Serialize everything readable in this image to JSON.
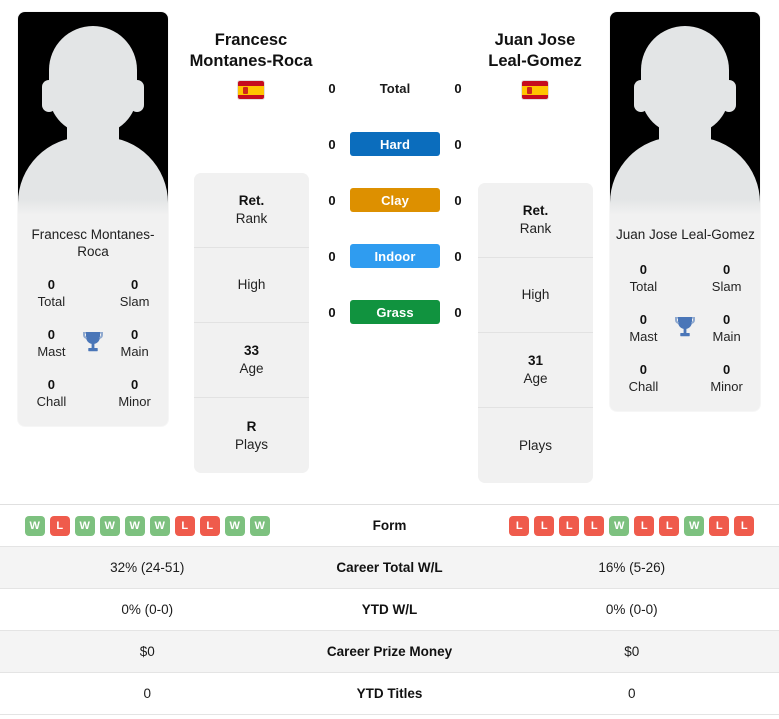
{
  "players": {
    "left": {
      "name_line1": "Francesc",
      "name_line2": "Montanes-Roca",
      "card_name": "Francesc Montanes-Roca",
      "country": "Spain",
      "flag": "spain-flag-icon",
      "avatar": "player-avatar-placeholder",
      "titles": {
        "total_value": "0",
        "total_label": "Total",
        "slam_value": "0",
        "slam_label": "Slam",
        "mast_value": "0",
        "mast_label": "Mast",
        "main_value": "0",
        "main_label": "Main",
        "chall_value": "0",
        "chall_label": "Chall",
        "minor_value": "0",
        "minor_label": "Minor",
        "trophy_icon": "trophy-icon"
      },
      "info": [
        {
          "value": "Ret.",
          "label": "Rank"
        },
        {
          "value": "",
          "label": "High"
        },
        {
          "value": "33",
          "label": "Age"
        },
        {
          "value": "R",
          "label": "Plays"
        }
      ],
      "surface_values": [
        "0",
        "0",
        "0",
        "0",
        "0"
      ],
      "form": [
        "W",
        "L",
        "W",
        "W",
        "W",
        "W",
        "L",
        "L",
        "W",
        "W"
      ],
      "career_total_wl": "32% (24-51)",
      "ytd_wl": "0% (0-0)",
      "career_prize_money": "$0",
      "ytd_titles": "0"
    },
    "right": {
      "name_line1": "Juan Jose",
      "name_line2": "Leal-Gomez",
      "card_name": "Juan Jose Leal-Gomez",
      "country": "Spain",
      "flag": "spain-flag-icon",
      "avatar": "player-avatar-placeholder",
      "titles": {
        "total_value": "0",
        "total_label": "Total",
        "slam_value": "0",
        "slam_label": "Slam",
        "mast_value": "0",
        "mast_label": "Mast",
        "main_value": "0",
        "main_label": "Main",
        "chall_value": "0",
        "chall_label": "Chall",
        "minor_value": "0",
        "minor_label": "Minor",
        "trophy_icon": "trophy-icon"
      },
      "info": [
        {
          "value": "Ret.",
          "label": "Rank"
        },
        {
          "value": "",
          "label": "High"
        },
        {
          "value": "31",
          "label": "Age"
        },
        {
          "value": "",
          "label": "Plays"
        }
      ],
      "surface_values": [
        "0",
        "0",
        "0",
        "0",
        "0"
      ],
      "form": [
        "L",
        "L",
        "L",
        "L",
        "W",
        "L",
        "L",
        "W",
        "L",
        "L"
      ],
      "career_total_wl": "16% (5-26)",
      "ytd_wl": "0% (0-0)",
      "career_prize_money": "$0",
      "ytd_titles": "0"
    }
  },
  "surfaces": [
    {
      "label": "Total",
      "color": "transparent",
      "text_color": "#1a1a1a",
      "plain": true
    },
    {
      "label": "Hard",
      "color": "#0b6dbd",
      "text_color": "#ffffff",
      "plain": false
    },
    {
      "label": "Clay",
      "color": "#dd9000",
      "text_color": "#ffffff",
      "plain": false
    },
    {
      "label": "Indoor",
      "color": "#2f9cf0",
      "text_color": "#ffffff",
      "plain": false
    },
    {
      "label": "Grass",
      "color": "#11933f",
      "text_color": "#ffffff",
      "plain": false
    }
  ],
  "table": {
    "rows": [
      {
        "label": "Form",
        "type": "form"
      },
      {
        "label": "Career Total W/L",
        "type": "text",
        "key": "career_total_wl"
      },
      {
        "label": "YTD W/L",
        "type": "text",
        "key": "ytd_wl"
      },
      {
        "label": "Career Prize Money",
        "type": "text",
        "key": "career_prize_money"
      },
      {
        "label": "YTD Titles",
        "type": "text",
        "key": "ytd_titles"
      }
    ]
  },
  "colors": {
    "win_badge": "#7dc17f",
    "loss_badge": "#ef5b4c",
    "panel_bg": "#f1f1f1",
    "row_alt_bg": "#f4f4f4",
    "trophy": "#4a76b8"
  }
}
